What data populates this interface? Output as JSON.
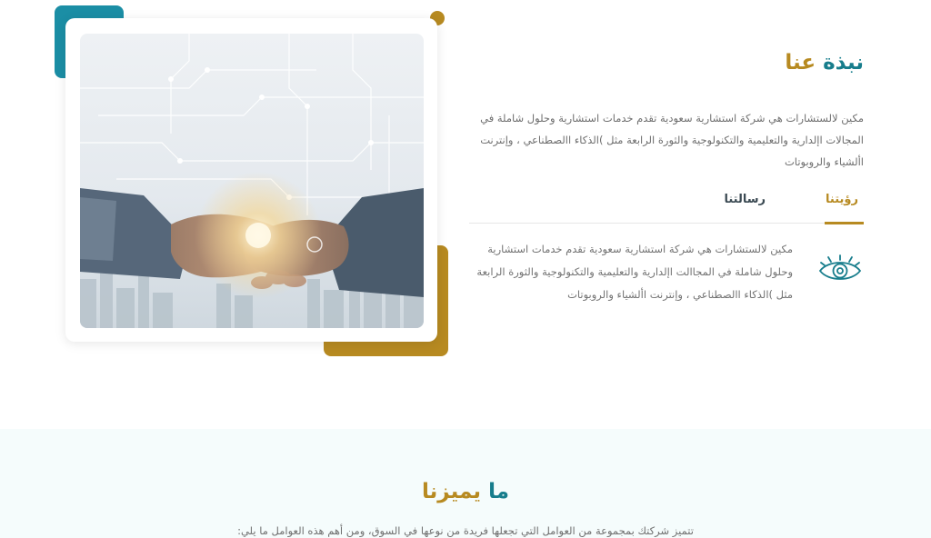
{
  "about": {
    "title_part1": "نبذة",
    "title_part2": "عنا",
    "description": "مكين لالستشارات هي شركة استشارية سعودية تقدم خدمات استشارية وحلول شاملة في المجالات اإلدارية والتعليمية والتكنولوجية والثورة الرابعة مثل )الذكاء االصطناعي ، وإنترنت األشياء والروبوتات",
    "image_icon": "business-handshake-image"
  },
  "tabs": {
    "items": [
      {
        "label": "رؤيتنا",
        "active": true
      },
      {
        "label": "رسالتنا",
        "active": false
      }
    ],
    "active_content": "مكين لالستشارات هي شركة استشارية سعودية تقدم خدمات استشارية وحلول شاملة في المجاالت اإلدارية والتعليمية والتكنولوجية والثورة الرابعة مثل )الذكاء االصطناعي ، وإنترنت األشياء والروبوتات",
    "active_icon": "eye-icon"
  },
  "features": {
    "title_part1": "ما",
    "title_part2": "يميزنا",
    "subtitle": "تتميز شركتك بمجموعة من العوامل التي تجعلها فريدة من نوعها في السوق، ومن أهم هذه العوامل ما يلي:"
  },
  "colors": {
    "teal": "#177d8c",
    "gold": "#b78a21",
    "light_bg": "#f5fcfc"
  }
}
